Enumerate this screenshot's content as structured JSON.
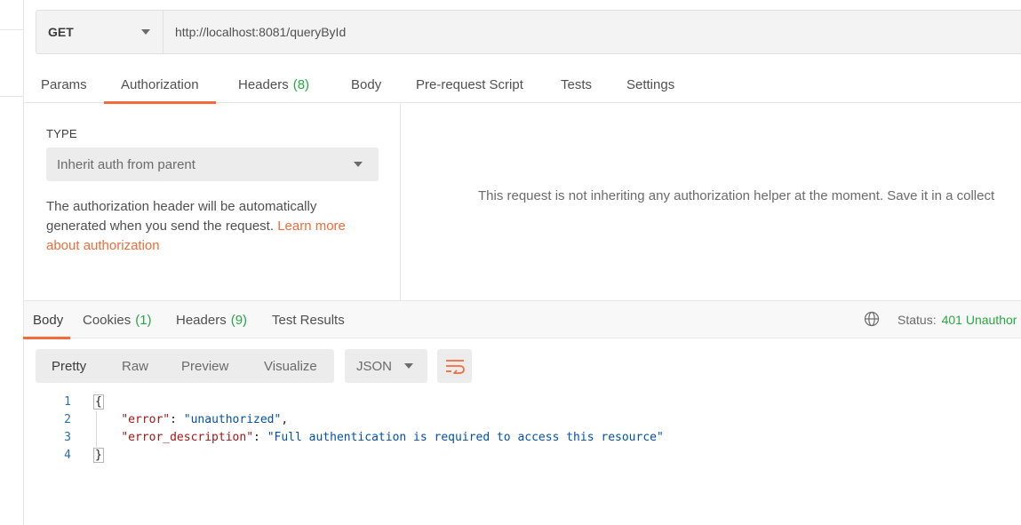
{
  "request": {
    "method": "GET",
    "url": "http://localhost:8081/queryById"
  },
  "request_tabs": [
    {
      "label": "Params",
      "count": ""
    },
    {
      "label": "Authorization",
      "count": "",
      "active": true
    },
    {
      "label": "Headers",
      "count": "(8)"
    },
    {
      "label": "Body",
      "count": ""
    },
    {
      "label": "Pre-request Script",
      "count": ""
    },
    {
      "label": "Tests",
      "count": ""
    },
    {
      "label": "Settings",
      "count": ""
    }
  ],
  "auth": {
    "type_label": "TYPE",
    "type_value": "Inherit auth from parent",
    "description": "The authorization header will be automatically generated when you send the request. ",
    "link_text": "Learn more about authorization",
    "inherit_message": "This request is not inheriting any authorization helper at the moment. Save it in a collect"
  },
  "response_tabs": [
    {
      "label": "Body",
      "count": "",
      "active": true
    },
    {
      "label": "Cookies",
      "count": "(1)"
    },
    {
      "label": "Headers",
      "count": "(9)"
    },
    {
      "label": "Test Results",
      "count": ""
    }
  ],
  "status": {
    "label": "Status:",
    "value": "401 Unauthor"
  },
  "view_modes": [
    "Pretty",
    "Raw",
    "Preview",
    "Visualize"
  ],
  "active_view": "Pretty",
  "format": "JSON",
  "code_lines": [
    {
      "num": "1",
      "text": "{"
    },
    {
      "num": "2",
      "key": "\"error\"",
      "sep": ": ",
      "value": "\"unauthorized\"",
      "end": ","
    },
    {
      "num": "3",
      "key": "\"error_description\"",
      "sep": ": ",
      "value": "\"Full authentication is required to access this resource\"",
      "end": ""
    },
    {
      "num": "4",
      "text": "}"
    }
  ],
  "colors": {
    "accent": "#f26b3a",
    "count_green": "#27a844",
    "json_key": "#a31515",
    "json_string": "#0451a5"
  },
  "icons": {
    "method_dropdown": "chevron-down-icon",
    "auth_dropdown": "chevron-down-icon",
    "status_globe": "globe-icon",
    "format_dropdown": "chevron-down-icon",
    "wrap": "wrap-lines-icon"
  }
}
